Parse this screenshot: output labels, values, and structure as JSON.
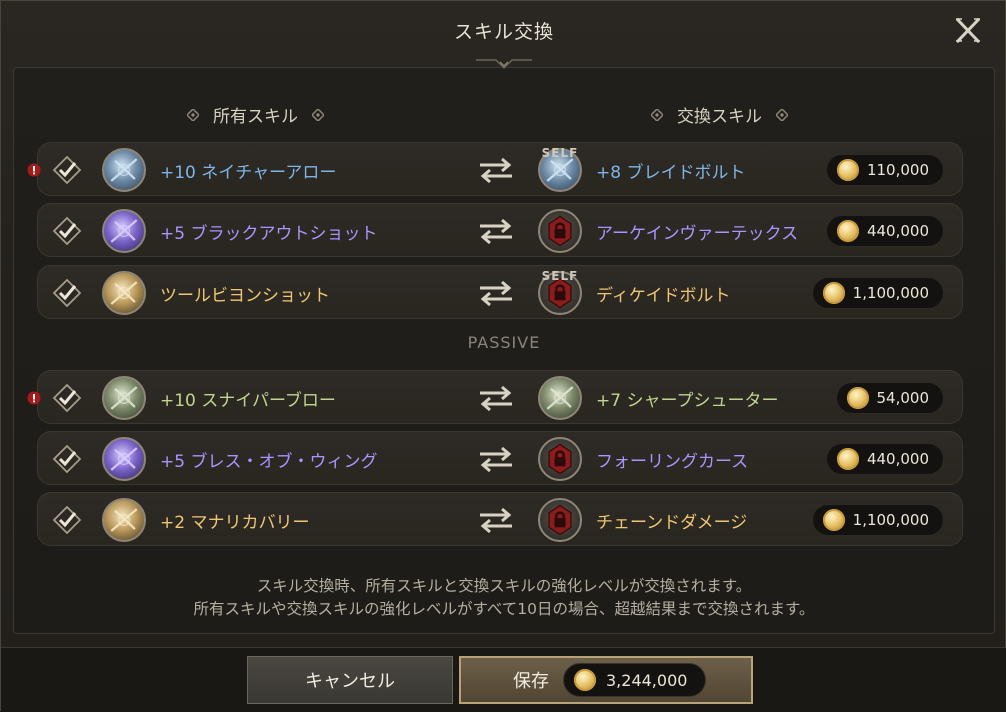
{
  "window": {
    "title": "スキル交換",
    "close_label": "X"
  },
  "columns": {
    "owned": "所有スキル",
    "exchange": "交換スキル"
  },
  "active_rows": [
    {
      "warn": true,
      "owned": "+10 ネイチャーアロー",
      "owned_color": "blue",
      "target": "+8 ブレイドボルト",
      "target_color": "blue",
      "price": "110,000",
      "self_badge": "SELF"
    },
    {
      "warn": false,
      "owned": "+5 ブラックアウトショット",
      "owned_color": "purple",
      "target": "アーケインヴァーテックス",
      "target_color": "purple",
      "price": "440,000"
    },
    {
      "warn": false,
      "owned": "ツールビヨンショット",
      "owned_color": "gold",
      "target": "ディケイドボルト",
      "target_color": "gold",
      "price": "1,100,000",
      "self_badge": "SELF"
    }
  ],
  "passive_label": "PASSIVE",
  "passive_rows": [
    {
      "warn": true,
      "owned": "+10 スナイパーブロー",
      "owned_color": "green",
      "target": "+7 シャープシューター",
      "target_color": "green",
      "price": "54,000"
    },
    {
      "warn": false,
      "owned": "+5 ブレス・オブ・ウィング",
      "owned_color": "purple",
      "target": "フォーリングカース",
      "target_color": "purple",
      "price": "440,000"
    },
    {
      "warn": false,
      "owned": "+2 マナリカバリー",
      "owned_color": "gold",
      "target": "チェーンドダメージ",
      "target_color": "gold",
      "price": "1,100,000"
    }
  ],
  "notice": {
    "line1": "スキル交換時、所有スキルと交換スキルの強化レベルが交換されます。",
    "line2": "所有スキルや交換スキルの強化レベルがすべて10日の場合、超越結果まで交換されます。"
  },
  "footer": {
    "cancel_label": "キャンセル",
    "save_label": "保存",
    "total_cost": "3,244,000"
  },
  "colors": {
    "blue": "#7fb5e6",
    "purple": "#a895ff",
    "gold": "#f0c674",
    "green": "#c2d58f",
    "accent": "#b8a27a"
  }
}
